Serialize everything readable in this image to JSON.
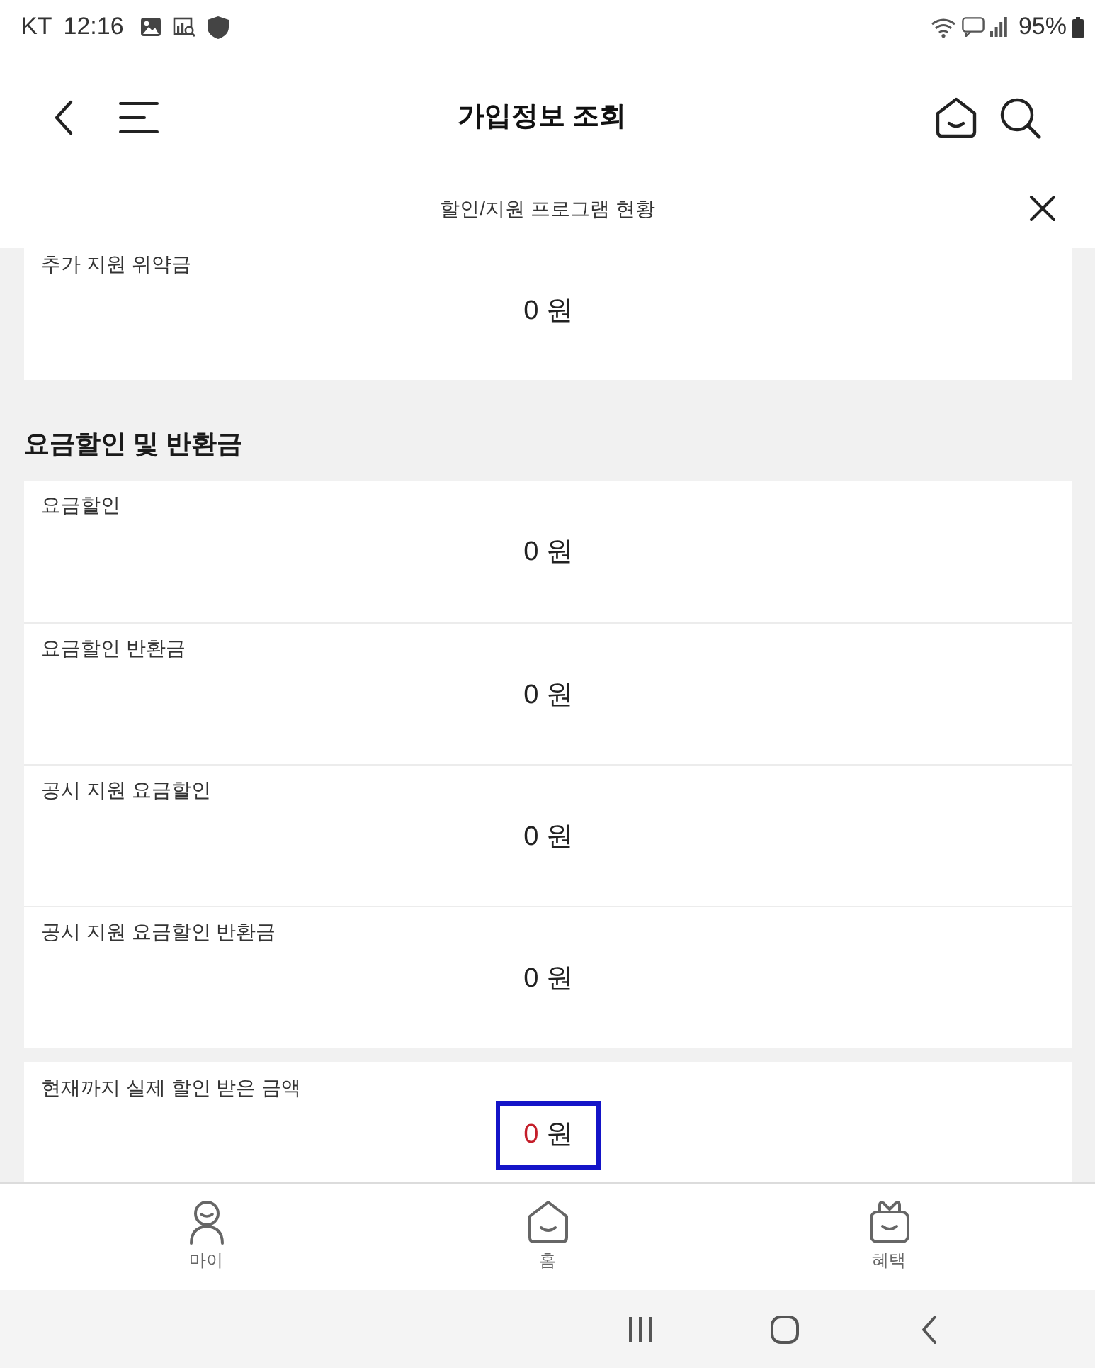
{
  "status_bar": {
    "carrier": "KT",
    "time": "12:16",
    "battery": "95%"
  },
  "header": {
    "title": "가입정보 조회"
  },
  "sub_header": {
    "title": "할인/지원 프로그램 현황"
  },
  "groups": [
    {
      "items": [
        {
          "label": "추가 지원 위약금",
          "amount": "0",
          "unit": "원",
          "highlighted": false
        }
      ]
    },
    {
      "heading": "요금할인 및 반환금",
      "items": [
        {
          "label": "요금할인",
          "amount": "0",
          "unit": "원",
          "highlighted": false
        },
        {
          "label": "요금할인 반환금",
          "amount": "0",
          "unit": "원",
          "highlighted": false
        },
        {
          "label": "공시 지원 요금할인",
          "amount": "0",
          "unit": "원",
          "highlighted": false
        },
        {
          "label": "공시 지원 요금할인 반환금",
          "amount": "0",
          "unit": "원",
          "highlighted": false
        }
      ]
    },
    {
      "items": [
        {
          "label": "현재까지 실제 할인 받은 금액",
          "amount": "0",
          "unit": "원",
          "highlighted": true
        }
      ]
    }
  ],
  "bottom_nav": [
    {
      "label": "마이",
      "kind": "person",
      "selected": false
    },
    {
      "label": "홈",
      "kind": "home",
      "selected": false
    },
    {
      "label": "혜택",
      "kind": "gift",
      "selected": false
    }
  ]
}
